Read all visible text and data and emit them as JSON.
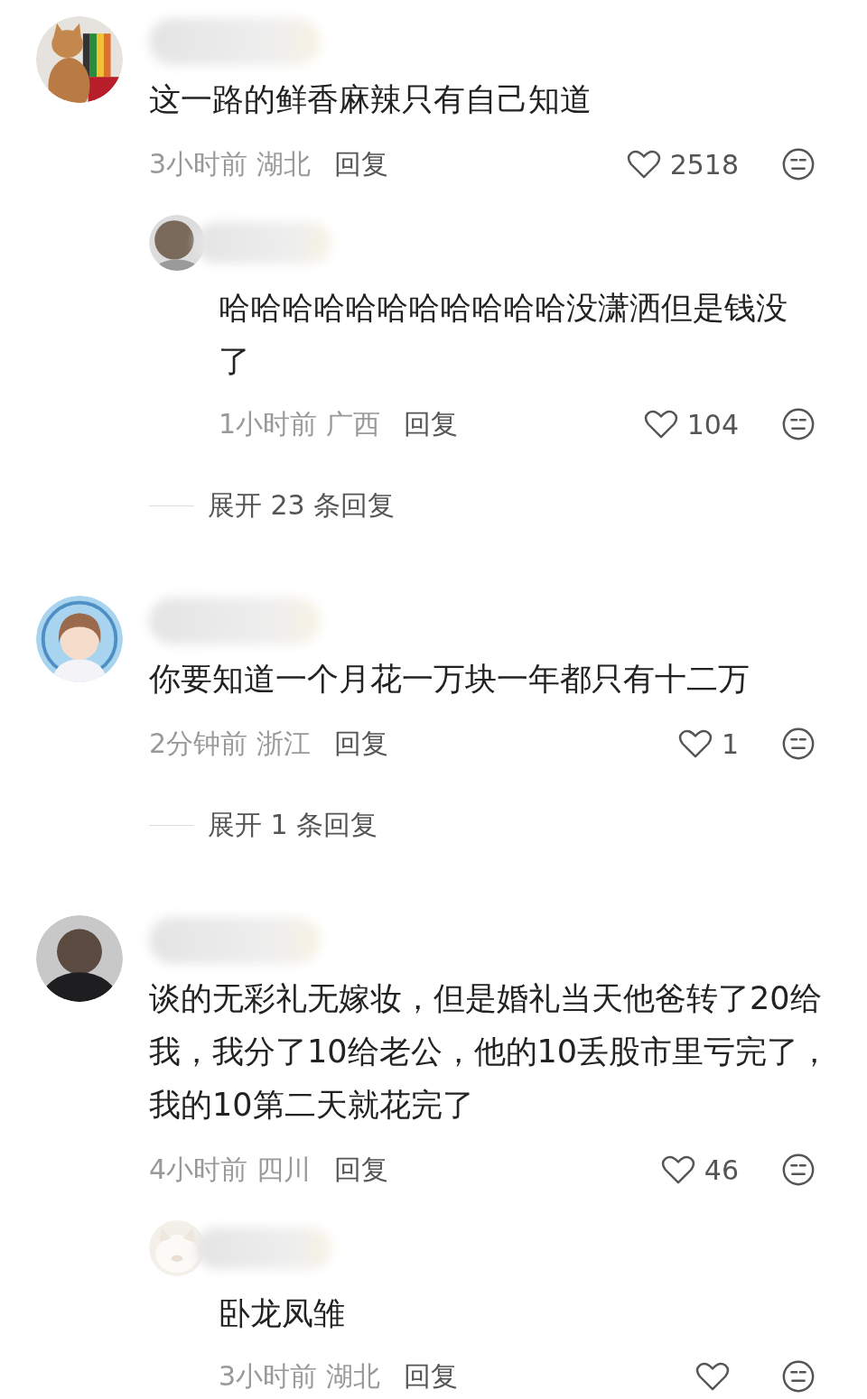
{
  "comments": [
    {
      "text": "这一路的鲜香麻辣只有自己知道",
      "time": "3小时前",
      "location": "湖北",
      "reply_action": "回复",
      "likes": "2518",
      "replies": [
        {
          "text": "哈哈哈哈哈哈哈哈哈哈哈没潇洒但是钱没了",
          "time": "1小时前",
          "location": "广西",
          "reply_action": "回复",
          "likes": "104"
        }
      ],
      "expand": "展开 23 条回复"
    },
    {
      "text": "你要知道一个月花一万块一年都只有十二万",
      "time": "2分钟前",
      "location": "浙江",
      "reply_action": "回复",
      "likes": "1",
      "expand": "展开 1 条回复"
    },
    {
      "text": "谈的无彩礼无嫁妆，但是婚礼当天他爸转了20给我，我分了10给老公，他的10丢股市里亏完了，我的10第二天就花完了",
      "time": "4小时前",
      "location": "四川",
      "reply_action": "回复",
      "likes": "46",
      "replies": [
        {
          "text": "卧龙凤雏",
          "time": "3小时前",
          "location": "湖北",
          "reply_action": "回复"
        }
      ]
    }
  ]
}
